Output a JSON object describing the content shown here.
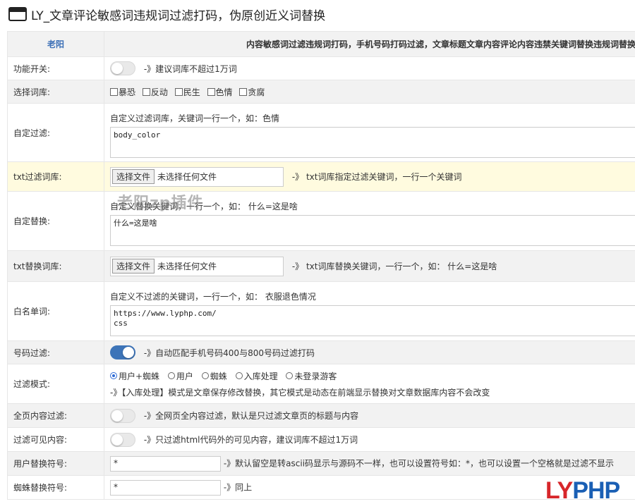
{
  "page": {
    "title": "LY_文章评论敏感词违规词过滤打码，伪原创近义词替换",
    "watermark": "老阳zp插件",
    "logo_part1": "LY",
    "logo_part2": "PHP"
  },
  "header": {
    "brand": "老阳",
    "description": "内容敏感词过滤违规词打码，手机号码打码过滤，文章标题文章内容评论内容违禁关键词替换违规词替换"
  },
  "rows": {
    "func_switch": {
      "label": "功能开关:",
      "on": false,
      "hint": "-》建议词库不超过1万词"
    },
    "lexicon": {
      "label": "选择词库:",
      "options": [
        "暴恐",
        "反动",
        "民生",
        "色情",
        "贪腐"
      ]
    },
    "custom_filter": {
      "label": "自定过滤:",
      "help": "自定义过滤词库，关键词一行一个，如：色情",
      "value": "body_color"
    },
    "txt_filter": {
      "label": "txt过滤词库:",
      "button": "选择文件",
      "status": "未选择任何文件",
      "hint": "-》 txt词库指定过滤关键词，一行一个关键词"
    },
    "custom_replace": {
      "label": "自定替换:",
      "help": "自定义替换关键词，一行一个，如： 什么=这是啥",
      "value": "什么=这是啥"
    },
    "txt_replace": {
      "label": "txt替换词库:",
      "button": "选择文件",
      "status": "未选择任何文件",
      "hint": "-》 txt词库替换关键词，一行一个，如： 什么=这是啥"
    },
    "whitelist": {
      "label": "白名单词:",
      "help": "自定义不过滤的关键词，一行一个，如： 衣服退色情况",
      "value": "https://www.lyphp.com/\ncss"
    },
    "phone_filter": {
      "label": "号码过滤:",
      "on": true,
      "hint": "-》自动匹配手机号码400与800号码过滤打码"
    },
    "filter_mode": {
      "label": "过滤模式:",
      "options": [
        "用户+蜘蛛",
        "用户",
        "蜘蛛",
        "入库处理",
        "未登录游客"
      ],
      "selected": "用户+蜘蛛",
      "note": "-》【入库处理】模式是文章保存修改替换，其它模式是动态在前端显示替换对文章数据库内容不会改变"
    },
    "full_page": {
      "label": "全页内容过滤:",
      "on": false,
      "hint": "-》全网页全内容过滤，默认是只过滤文章页的标题与内容"
    },
    "visible_only": {
      "label": "过滤可见内容:",
      "on": false,
      "hint": "-》只过滤html代码外的可见内容，建议词库不超过1万词"
    },
    "user_symbol": {
      "label": "用户替换符号:",
      "value": "*",
      "hint": "-》默认留空是转ascii码显示与源码不一样，也可以设置符号如：*，也可以设置一个空格就是过滤不显示"
    },
    "spider_symbol": {
      "label": "蜘蛛替换符号:",
      "value": "*",
      "hint": "-》同上"
    }
  }
}
